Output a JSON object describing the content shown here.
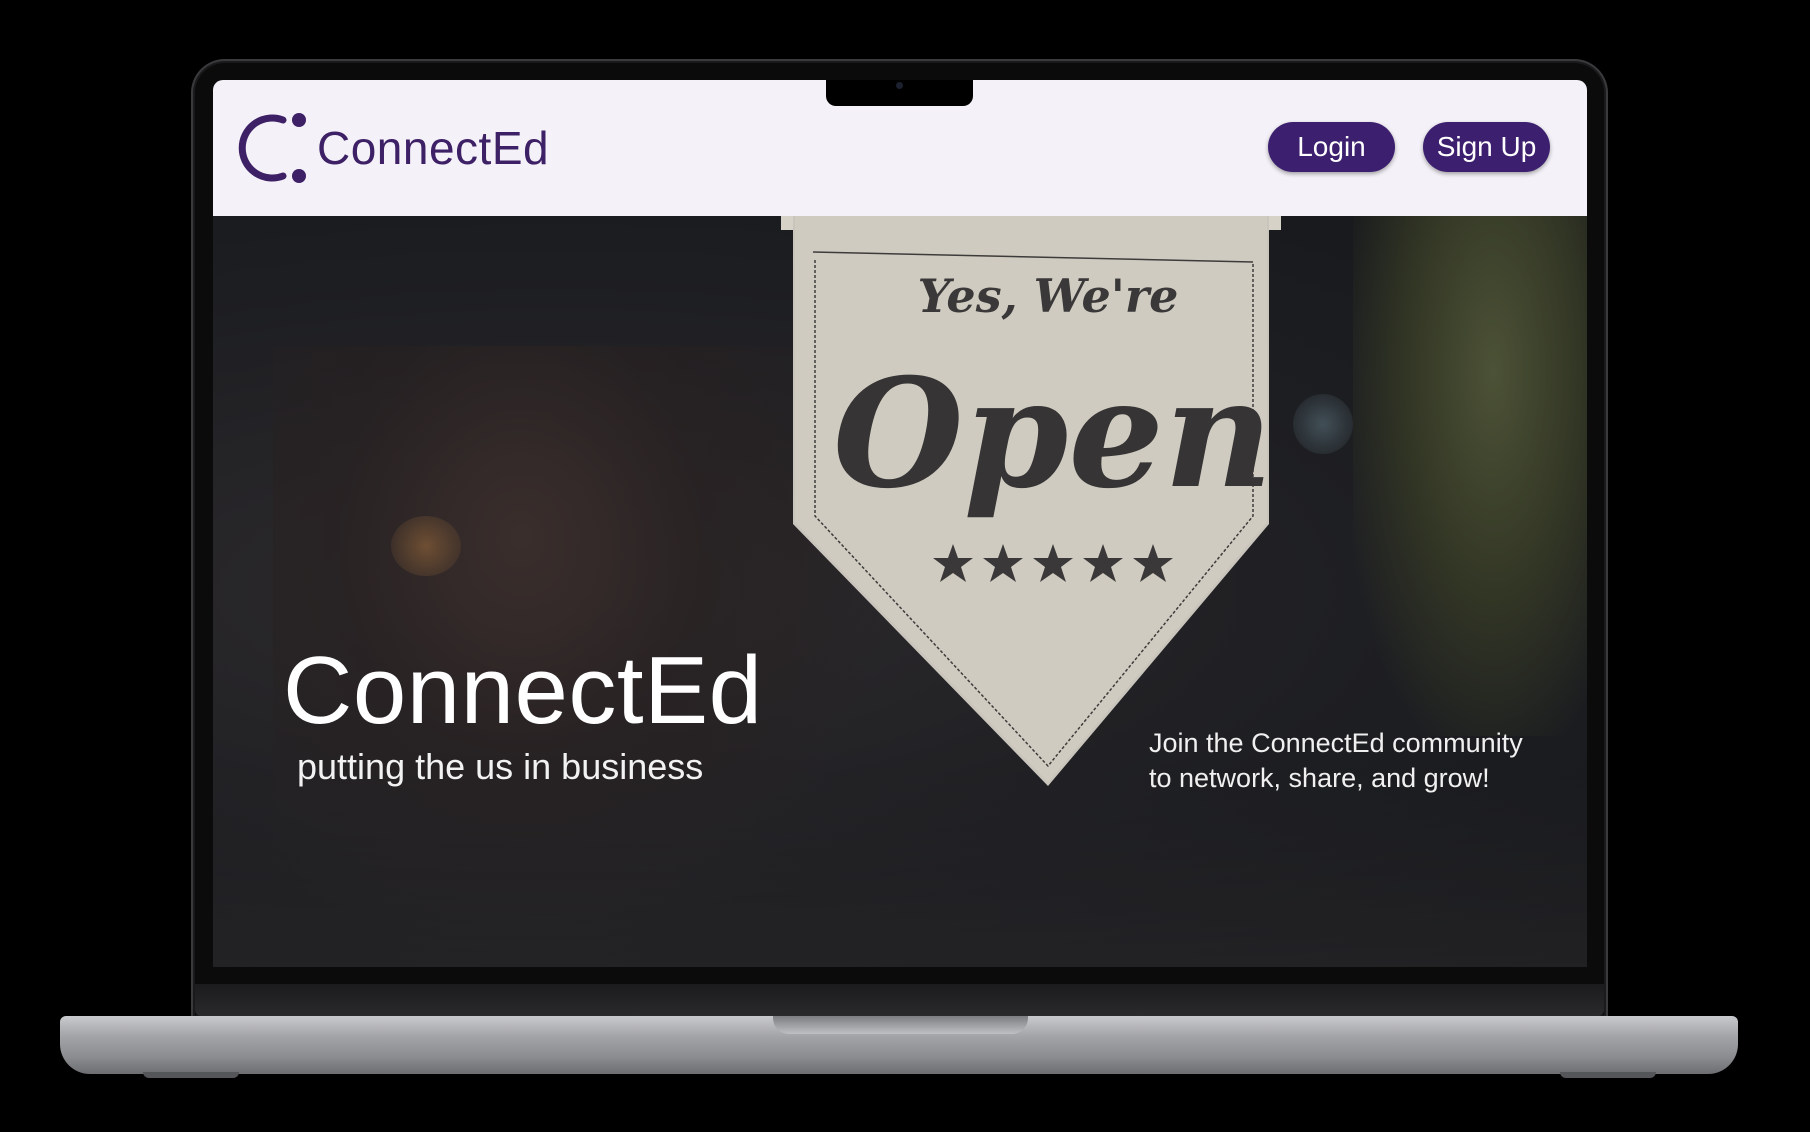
{
  "header": {
    "brand_name": "ConnectEd",
    "login_label": "Login",
    "signup_label": "Sign Up"
  },
  "hero": {
    "title": "ConnectEd",
    "tagline": "putting the us in business",
    "join_line1": "Join the ConnectEd community",
    "join_line2": "to network, share, and grow!",
    "sign_line1": "Yes, We're",
    "sign_line2": "Open",
    "sign_rating_stars": 5
  },
  "colors": {
    "brand_purple": "#3c1f6e",
    "header_bg": "#f4f2f8"
  },
  "icons": {
    "logo": "connected-logo-icon",
    "star": "star-icon"
  }
}
